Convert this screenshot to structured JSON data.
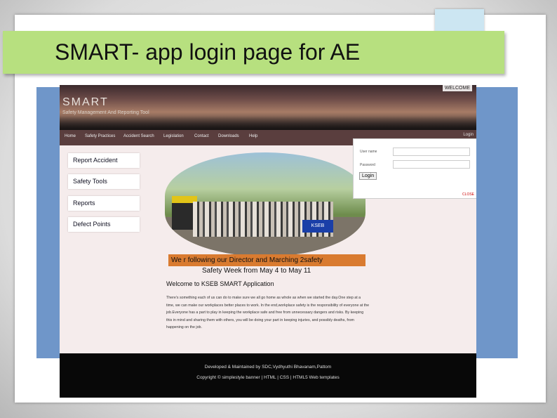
{
  "slide": {
    "title": "SMART- app login page for AE"
  },
  "site": {
    "logo": "SMART",
    "tagline": "Safety Management And Reporting Tool",
    "welcome_tag": "WELCOME",
    "nav": {
      "items": [
        "Home",
        "Safety Practices",
        "Accident Search",
        "Legislation",
        "Contact",
        "Downloads",
        "Help"
      ],
      "login": "Login"
    },
    "side_menu": [
      "Report Accident",
      "Safety Tools",
      "Reports",
      "Defect Points"
    ],
    "login_panel": {
      "username_label": "User name",
      "password_label": "Password",
      "login_button": "Login",
      "close_link": "CLOSE"
    },
    "photo": {
      "banner_text": "KSEB"
    },
    "caption": "We r following  our Director and Marching  2safety",
    "safety_week": "Safety Week from May 4 to May 11",
    "welcome_heading": "Welcome to KSEB SMART Application",
    "intro": "There's something each of us can do to make sure we all go home as whole as when we started the day.One step at a time, we can make our workplaces better places to work. In the end,workplace safety is the responsibility of everyone at the job.Everyone has a part to play in keeping the workplace safe and free from unnecessary dangers and risks. By keeping this in mind and sharing them with others, you will be doing your part in keeping injuries, and possibly deaths, from happening on the job.",
    "footer": {
      "line1": "Developed & Maintained by SDC,Vydhyuthi Bhavanam,Pattom",
      "line2": "Copyright © simplestyle banner | HTML | CSS | HTML5 Web templates"
    }
  },
  "colors": {
    "title_banner": "#b7e07f",
    "blue_panel": "#6f96c9",
    "caption_bar": "#d97b30",
    "nav_bar": "#5a3e3e",
    "footer": "#080808"
  }
}
